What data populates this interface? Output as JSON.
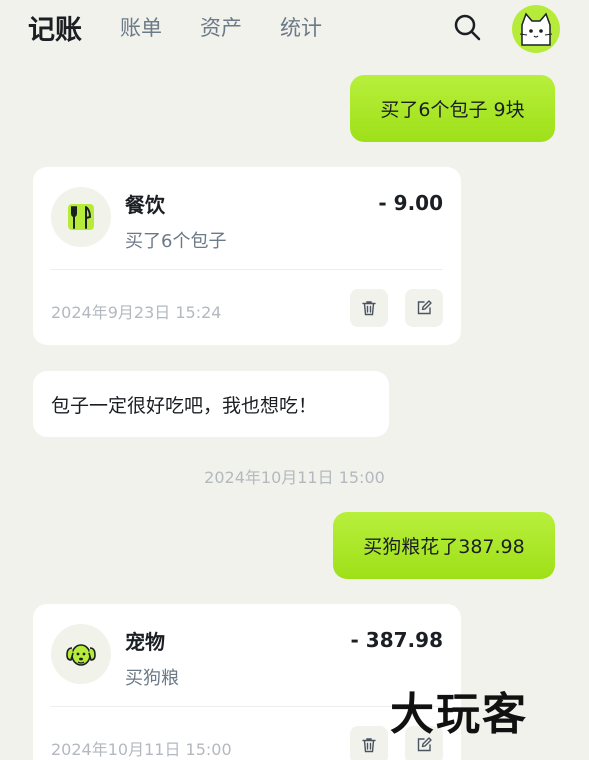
{
  "header": {
    "tabs": [
      {
        "label": "记账",
        "active": true
      },
      {
        "label": "账单",
        "active": false
      },
      {
        "label": "资产",
        "active": false
      },
      {
        "label": "统计",
        "active": false
      }
    ],
    "search_icon": "search-icon",
    "avatar_icon": "cat-avatar"
  },
  "messages": {
    "user_1": "买了6个包子 9块",
    "card_1": {
      "category": "餐饮",
      "category_icon": "fork-knife-icon",
      "note": "买了6个包子",
      "amount": "- 9.00",
      "time": "2024年9月23日 15:24"
    },
    "bot_1": "包子一定很好吃吧，我也想吃！",
    "timestamp": "2024年10月11日 15:00",
    "user_2": "买狗粮花了387.98",
    "card_2": {
      "category": "宠物",
      "category_icon": "dog-icon",
      "note": "买狗粮",
      "amount": "- 387.98",
      "time": "2024年10月11日 15:00"
    }
  },
  "watermark": "大玩客",
  "colors": {
    "background": "#f2f2ec",
    "accent_green": "#a6e526",
    "card": "#ffffff",
    "muted_text": "#6c7a87"
  }
}
